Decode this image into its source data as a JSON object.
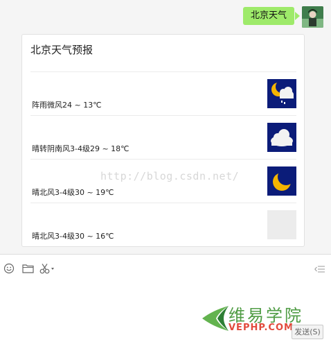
{
  "message": {
    "text": "北京天气"
  },
  "card": {
    "title": "北京天气预报",
    "rows": [
      {
        "text": "阵雨微风24 ~ 13℃",
        "icon": "moon-cloud-rain-icon"
      },
      {
        "text": "晴转阴南风3-4级29 ~ 18℃",
        "icon": "cloud-icon"
      },
      {
        "text": "晴北风3-4级30 ~ 19℃",
        "icon": "crescent-moon-icon"
      },
      {
        "text": "晴北风3-4级30 ~ 16℃",
        "icon": "placeholder-icon"
      }
    ]
  },
  "watermark": "http://blog.csdn.net/",
  "toolbar": {
    "emoji_icon": "emoji-icon",
    "folder_icon": "folder-icon",
    "scissors_icon": "scissors-icon",
    "collapse_icon": "collapse-icon"
  },
  "logo": {
    "cn": "维易学院",
    "en": "VEPHP.COM"
  },
  "send_button": "发送(S)",
  "colors": {
    "bubble": "#9eea6a",
    "icon_bg": "#0b1c79",
    "moon": "#f4b400",
    "logo_green": "#4f9c44",
    "logo_red": "#e24a3c"
  }
}
